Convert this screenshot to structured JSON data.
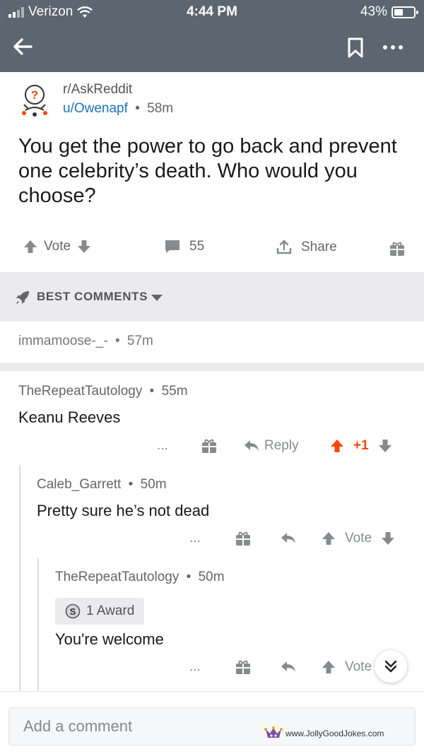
{
  "status_bar": {
    "carrier": "Verizon",
    "time": "4:44 PM",
    "battery": "43%",
    "battery_level": 0.43
  },
  "nav": {
    "back_icon": "arrow-left-icon",
    "save_icon": "bookmark-icon",
    "more_icon": "more-horizontal-icon"
  },
  "post": {
    "subreddit": "r/AskReddit",
    "author": "u/Owenapf",
    "separator": "•",
    "age": "58m",
    "title": "You get the power to go back and prevent one celebrity’s death. Who would you choose?",
    "vote_label": "Vote",
    "comment_count": "55",
    "share_label": "Share"
  },
  "sort": {
    "label": "BEST COMMENTS"
  },
  "collapsed_comment": {
    "author": "immamoose-_-",
    "age": "57m"
  },
  "comments": [
    {
      "author": "TheRepeatTautology",
      "age": "55m",
      "body": "Keanu Reeves",
      "reply_label": "Reply",
      "score": "+1",
      "upvoted": true,
      "more": "..."
    },
    {
      "author": "Caleb_Garrett",
      "age": "50m",
      "body": "Pretty sure he’s not dead",
      "vote_label": "Vote",
      "more": "..."
    },
    {
      "author": "TheRepeatTautology",
      "age": "50m",
      "award": "1 Award",
      "body": "You're welcome",
      "vote_label": "Vote",
      "more": "..."
    }
  ],
  "composer": {
    "placeholder": "Add a comment"
  },
  "watermark": {
    "text": "www.JollyGoodJokes.com"
  },
  "colors": {
    "header_bg": "#5b6670",
    "upvote": "#ff4500",
    "link_blue": "#2272b9"
  }
}
